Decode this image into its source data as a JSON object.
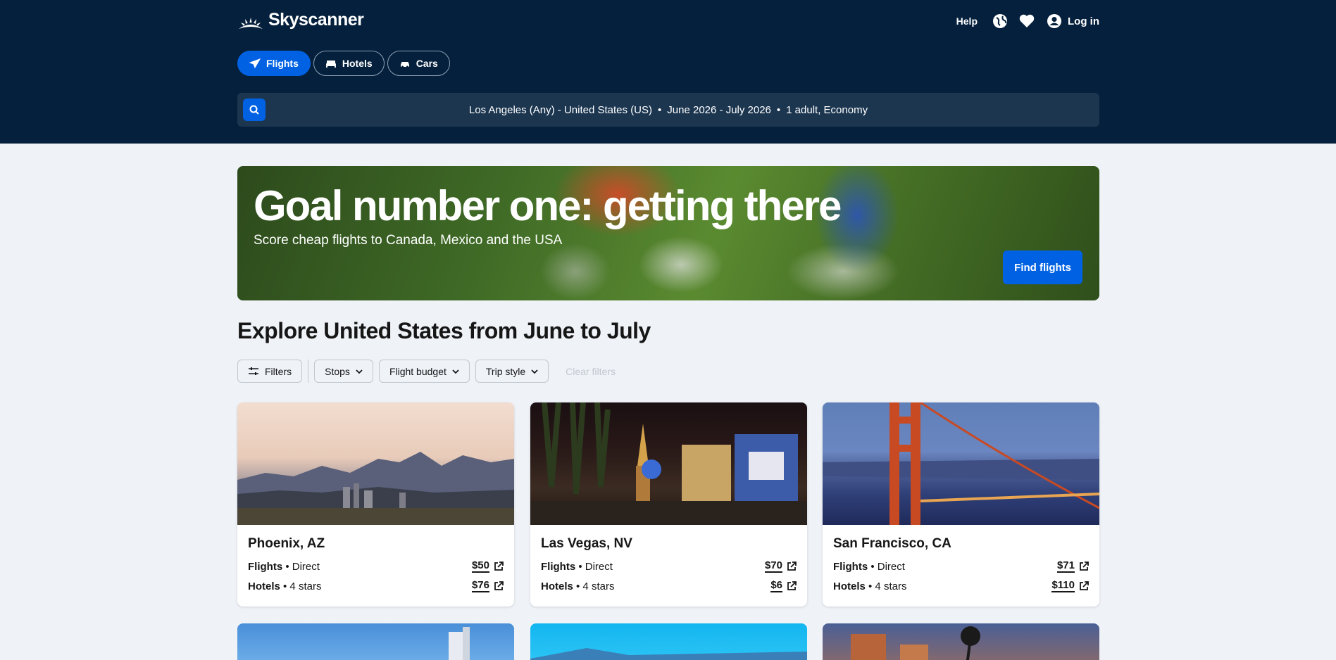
{
  "header": {
    "brand": "Skyscanner",
    "help": "Help",
    "login": "Log in",
    "icons": [
      "globe-icon",
      "heart-icon",
      "account-icon"
    ]
  },
  "tabs": [
    {
      "label": "Flights",
      "icon": "plane-icon",
      "active": true
    },
    {
      "label": "Hotels",
      "icon": "bed-icon",
      "active": false
    },
    {
      "label": "Cars",
      "icon": "car-icon",
      "active": false
    }
  ],
  "search": {
    "route": "Los Angeles (Any) - United States (US)",
    "dates": "June 2026 - July 2026",
    "travellers": "1 adult, Economy",
    "separator": "•"
  },
  "banner": {
    "title": "Goal number one: getting there",
    "subtitle": "Score cheap flights to Canada, Mexico and the USA",
    "cta": "Find flights"
  },
  "explore": {
    "title": "Explore United States from June to July"
  },
  "filters": {
    "filters_label": "Filters",
    "stops": "Stops",
    "budget": "Flight budget",
    "style": "Trip style",
    "clear": "Clear filters"
  },
  "cards": [
    {
      "city": "Phoenix, AZ",
      "flights_label": "Flights",
      "flights_detail": " • Direct",
      "flight_price": "$50",
      "hotels_label": "Hotels",
      "hotels_detail": " • 4 stars",
      "hotel_price": "$76"
    },
    {
      "city": "Las Vegas, NV",
      "flights_label": "Flights",
      "flights_detail": " • Direct",
      "flight_price": "$70",
      "hotels_label": "Hotels",
      "hotels_detail": " • 4 stars",
      "hotel_price": "$6"
    },
    {
      "city": "San Francisco, CA",
      "flights_label": "Flights",
      "flights_detail": " • Direct",
      "flight_price": "$71",
      "hotels_label": "Hotels",
      "hotels_detail": " • 4 stars",
      "hotel_price": "$110"
    }
  ],
  "colors": {
    "header_bg": "#05203c",
    "accent": "#0062e3",
    "page_bg": "#eff3f8"
  }
}
